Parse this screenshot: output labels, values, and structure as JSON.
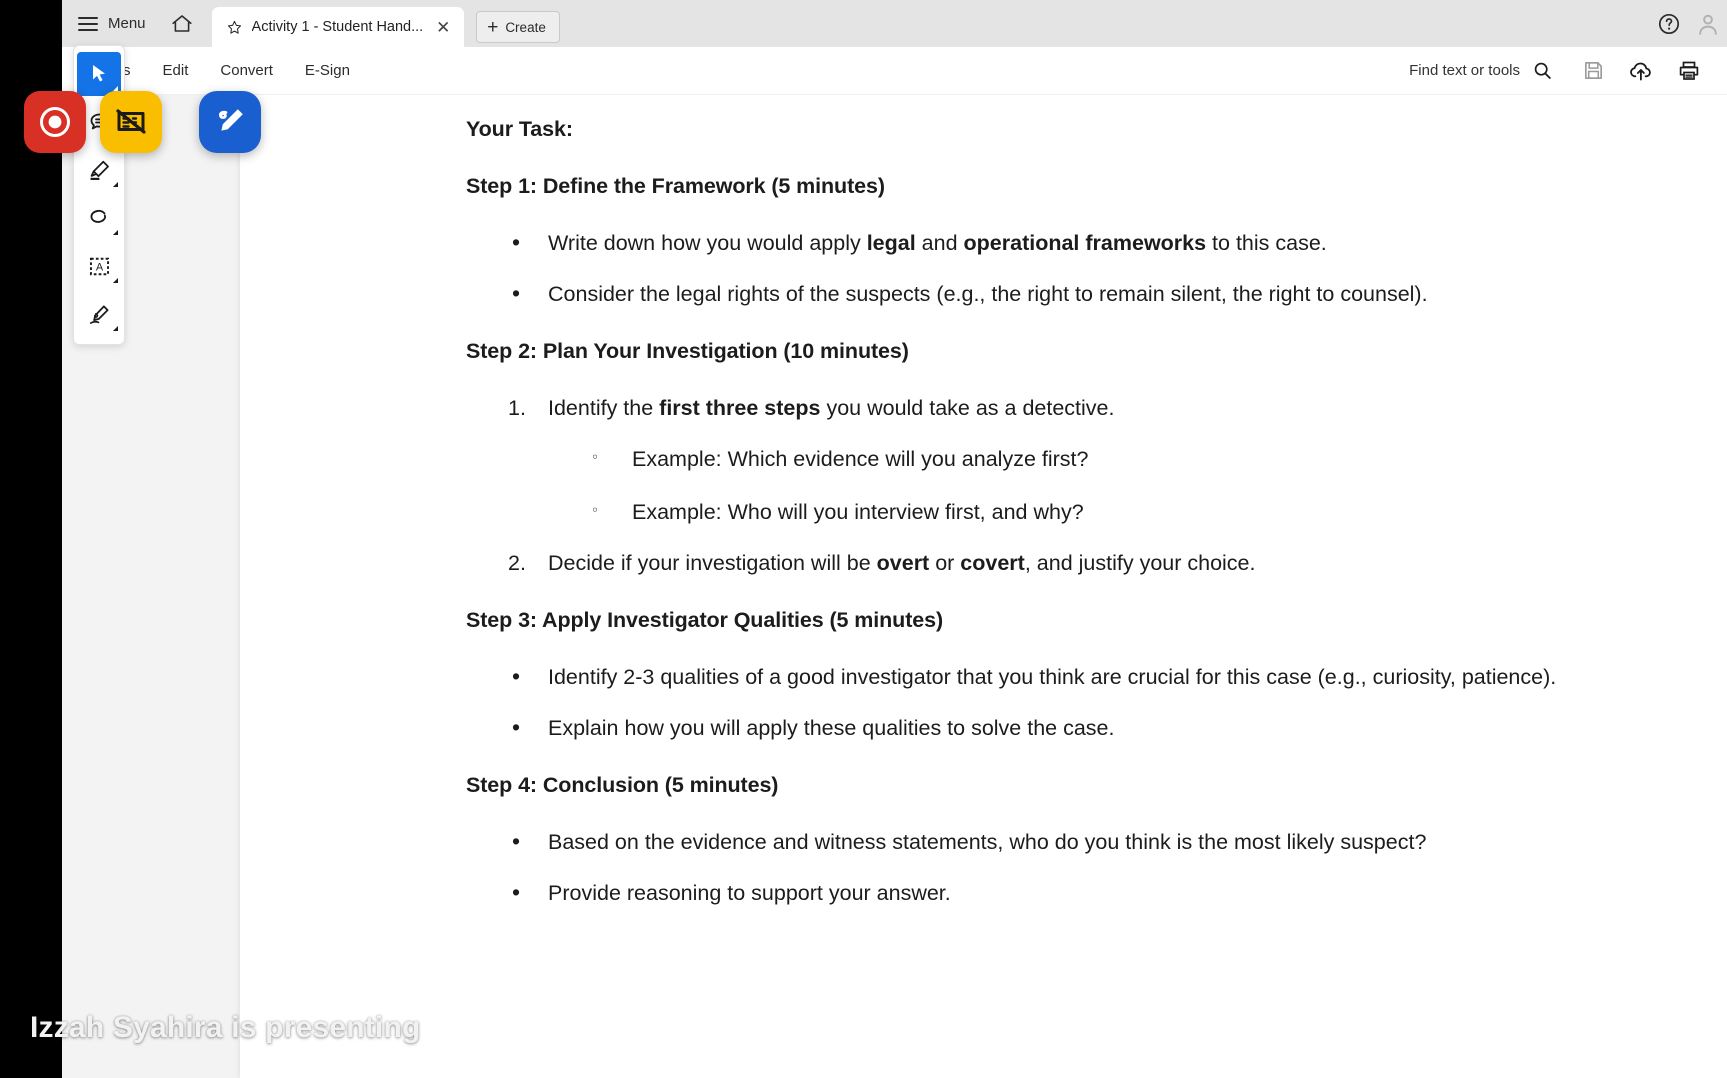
{
  "window": {
    "menu_label": "Menu",
    "home_icon": "home-icon",
    "tab": {
      "star_icon": "star-icon",
      "title": "Activity 1 - Student Hand...",
      "close_icon": "close-icon"
    },
    "create_button": {
      "plus": "+",
      "label": "Create"
    },
    "help_icon": "help-circle-icon",
    "avatar_icon": "account-icon"
  },
  "toolstrip": {
    "items": [
      {
        "label": "All tools",
        "name": "all-tools"
      },
      {
        "label": "Edit",
        "name": "edit"
      },
      {
        "label": "Convert",
        "name": "convert"
      },
      {
        "label": "E-Sign",
        "name": "e-sign"
      }
    ],
    "find": {
      "label": "Find text or tools",
      "icon": "search-icon"
    },
    "actions": [
      {
        "name": "save-icon"
      },
      {
        "name": "upload-cloud-icon"
      },
      {
        "name": "print-icon"
      }
    ]
  },
  "annotation_toolbar": {
    "tools": [
      {
        "name": "select-cursor-tool",
        "active": true
      },
      {
        "name": "comment-tool",
        "active": false
      },
      {
        "name": "highlighter-tool",
        "active": false
      },
      {
        "name": "lasso-draw-tool",
        "active": false
      },
      {
        "name": "text-select-tool",
        "active": false
      },
      {
        "name": "signature-tool",
        "active": false
      }
    ]
  },
  "meeting_controls": [
    {
      "name": "record-stop-button",
      "color": "#d93025"
    },
    {
      "name": "stop-screen-share-button",
      "color": "#f9be00"
    },
    {
      "name": "annotate-button",
      "color": "#1a5fd0"
    }
  ],
  "presenter_banner": "Izzah Syahira is presenting",
  "document": {
    "title": "Your Task:",
    "sections": [
      {
        "heading": "Step 1: Define the Framework (5 minutes)",
        "bullets": [
          {
            "parts": [
              {
                "t": "Write down how you would apply "
              },
              {
                "t": "legal",
                "b": true
              },
              {
                "t": " and "
              },
              {
                "t": "operational frameworks",
                "b": true
              },
              {
                "t": " to this case."
              }
            ]
          },
          {
            "parts": [
              {
                "t": "Consider the legal rights of the suspects (e.g., the right to remain silent, the right to counsel)."
              }
            ]
          }
        ]
      },
      {
        "heading": "Step 2: Plan Your Investigation (10 minutes)",
        "ordered": [
          {
            "parts": [
              {
                "t": "Identify the "
              },
              {
                "t": "first three steps",
                "b": true
              },
              {
                "t": " you would take as a detective."
              }
            ],
            "sub": [
              "Example: Which evidence will you analyze first?",
              "Example: Who will you interview first, and why?"
            ]
          },
          {
            "parts": [
              {
                "t": "Decide if your investigation will be "
              },
              {
                "t": "overt",
                "b": true
              },
              {
                "t": " or "
              },
              {
                "t": "covert",
                "b": true
              },
              {
                "t": ", and justify your choice."
              }
            ],
            "sub": []
          }
        ]
      },
      {
        "heading": "Step 3: Apply Investigator Qualities (5 minutes)",
        "bullets": [
          {
            "parts": [
              {
                "t": "Identify 2-3 qualities of a good investigator that you think are crucial for this case (e.g., curiosity, patience)."
              }
            ]
          },
          {
            "parts": [
              {
                "t": "Explain how you will apply these qualities to solve the case."
              }
            ]
          }
        ]
      },
      {
        "heading": "Step 4: Conclusion (5 minutes)",
        "bullets": [
          {
            "parts": [
              {
                "t": "Based on the evidence and witness statements, who do you think is the most likely suspect?"
              }
            ]
          },
          {
            "parts": [
              {
                "t": "Provide reasoning to support your answer."
              }
            ]
          }
        ]
      }
    ]
  }
}
